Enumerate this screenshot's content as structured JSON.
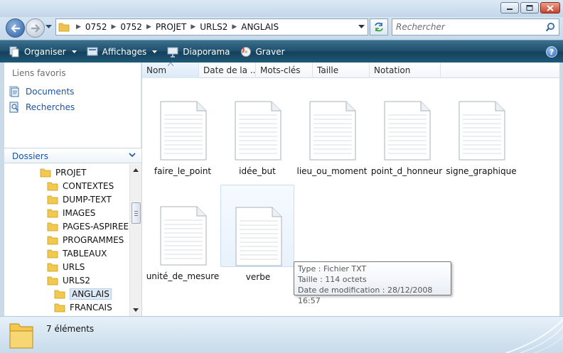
{
  "address": {
    "crumbs": [
      "0752",
      "0752",
      "PROJET",
      "URLS2",
      "ANGLAIS"
    ]
  },
  "search": {
    "placeholder": "Rechercher"
  },
  "toolbar": {
    "organiser": "Organiser",
    "affichages": "Affichages",
    "diaporama": "Diaporama",
    "graver": "Graver",
    "help": "?"
  },
  "favorites": {
    "header": "Liens favoris",
    "items": [
      {
        "label": "Documents",
        "icon": "documents-icon"
      },
      {
        "label": "Recherches",
        "icon": "searches-icon"
      }
    ]
  },
  "folders": {
    "header": "Dossiers",
    "tree": [
      {
        "label": "PROJET",
        "level": 1
      },
      {
        "label": "CONTEXTES",
        "level": 2
      },
      {
        "label": "DUMP-TEXT",
        "level": 2
      },
      {
        "label": "IMAGES",
        "level": 2
      },
      {
        "label": "PAGES-ASPIREES",
        "level": 2
      },
      {
        "label": "PROGRAMMES",
        "level": 2
      },
      {
        "label": "TABLEAUX",
        "level": 2
      },
      {
        "label": "URLS",
        "level": 2
      },
      {
        "label": "URLS2",
        "level": 2
      },
      {
        "label": "ANGLAIS",
        "level": 3,
        "selected": true
      },
      {
        "label": "FRANCAIS",
        "level": 3
      }
    ]
  },
  "columns": [
    "Nom",
    "Date de la ...",
    "Mots-clés",
    "Taille",
    "Notation"
  ],
  "files": [
    "faire_le_point",
    "idée_but",
    "lieu_ou_moment",
    "point_d_honneur",
    "signe_graphique",
    "unité_de_mesure",
    "verbe"
  ],
  "tooltip": {
    "type": "Type : Fichier TXT",
    "size": "Taille : 114 octets",
    "modified": "Date de modification : 28/12/2008 16:57"
  },
  "status": {
    "count": "7 éléments"
  },
  "colors": {
    "link": "#1b53a5",
    "commandbar": "#1f4f6c",
    "folder": "#f2c94c"
  }
}
